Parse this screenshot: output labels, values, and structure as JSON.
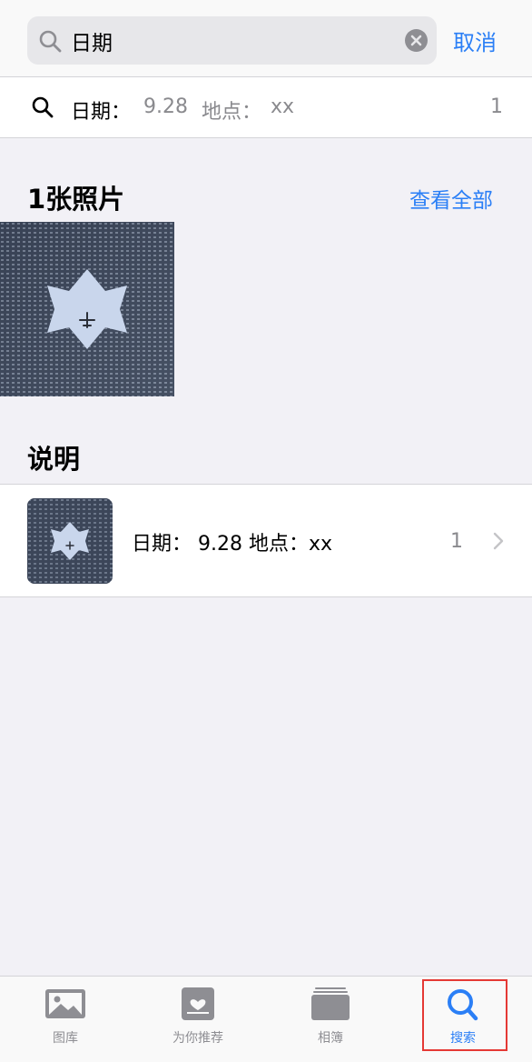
{
  "search": {
    "value": "日期",
    "cancel_label": "取消"
  },
  "suggestion": {
    "date_key": "日期：",
    "date_value": "9.28",
    "place_key": "地点：",
    "place_value": "xx",
    "count": "1"
  },
  "photos_section": {
    "title": "1张照片",
    "see_all": "查看全部"
  },
  "captions_section": {
    "title": "说明",
    "items": [
      {
        "text": "日期：  9.28  地点：xx",
        "count": "1"
      }
    ]
  },
  "tabbar": {
    "tabs": [
      {
        "label": "图库",
        "icon": "photo-library-icon",
        "active": false
      },
      {
        "label": "为你推荐",
        "icon": "for-you-icon",
        "active": false
      },
      {
        "label": "相簿",
        "icon": "albums-icon",
        "active": false
      },
      {
        "label": "搜索",
        "icon": "search-icon",
        "active": true
      }
    ]
  },
  "colors": {
    "accent": "#2b7ff6",
    "background": "#f2f1f6",
    "highlight": "#e53935"
  }
}
